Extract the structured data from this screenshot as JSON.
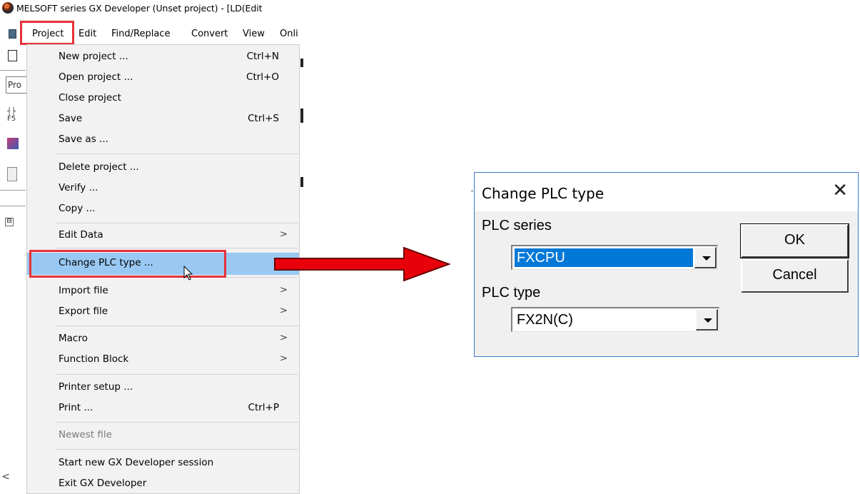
{
  "window": {
    "title": "MELSOFT series GX Developer (Unset project) - [LD(Edit"
  },
  "menubar": {
    "items": [
      "Project",
      "Edit",
      "Find/Replace",
      "Convert",
      "View",
      "Onli"
    ]
  },
  "toolbar": {
    "project_combo_value": "Pro",
    "f5_label": "F5"
  },
  "project_menu": {
    "items": [
      {
        "label": "New project ...",
        "shortcut": "Ctrl+N"
      },
      {
        "label": "Open project ...",
        "shortcut": "Ctrl+O"
      },
      {
        "label": "Close project",
        "shortcut": ""
      },
      {
        "label": "Save",
        "shortcut": "Ctrl+S"
      },
      {
        "label": "Save as ...",
        "shortcut": ""
      },
      {
        "label": "Delete project ...",
        "shortcut": ""
      },
      {
        "label": "Verify ...",
        "shortcut": ""
      },
      {
        "label": "Copy ...",
        "shortcut": ""
      },
      {
        "label": "Edit Data",
        "submenu_arrow": ">"
      },
      {
        "label": "Change PLC type ...",
        "highlighted": true
      },
      {
        "label": "Import file",
        "submenu_arrow": ">"
      },
      {
        "label": "Export file",
        "submenu_arrow": ">"
      },
      {
        "label": "Macro",
        "submenu_arrow": ">"
      },
      {
        "label": "Function Block",
        "submenu_arrow": ">"
      },
      {
        "label": "Printer setup ...",
        "shortcut": ""
      },
      {
        "label": "Print ...",
        "shortcut": "Ctrl+P"
      },
      {
        "label": "Newest file",
        "disabled": true
      },
      {
        "label": "Start new GX Developer session"
      },
      {
        "label": "Exit GX Developer"
      }
    ]
  },
  "dialog": {
    "title": "Change PLC type",
    "close_glyph": "✕",
    "plc_series_label": "PLC series",
    "plc_series_value": "FXCPU",
    "plc_type_label": "PLC type",
    "plc_type_value": "FX2N(C)",
    "ok_label": "OK",
    "cancel_label": "Cancel"
  },
  "tree": {
    "expander_glyph": "⊟",
    "scroll_left_glyph": "<"
  },
  "colors": {
    "highlight_border": "#e53238",
    "selected_item_bg": "#99c9f3",
    "selected_combo_bg": "#0078d7",
    "arrow_fill": "#e8000b"
  }
}
